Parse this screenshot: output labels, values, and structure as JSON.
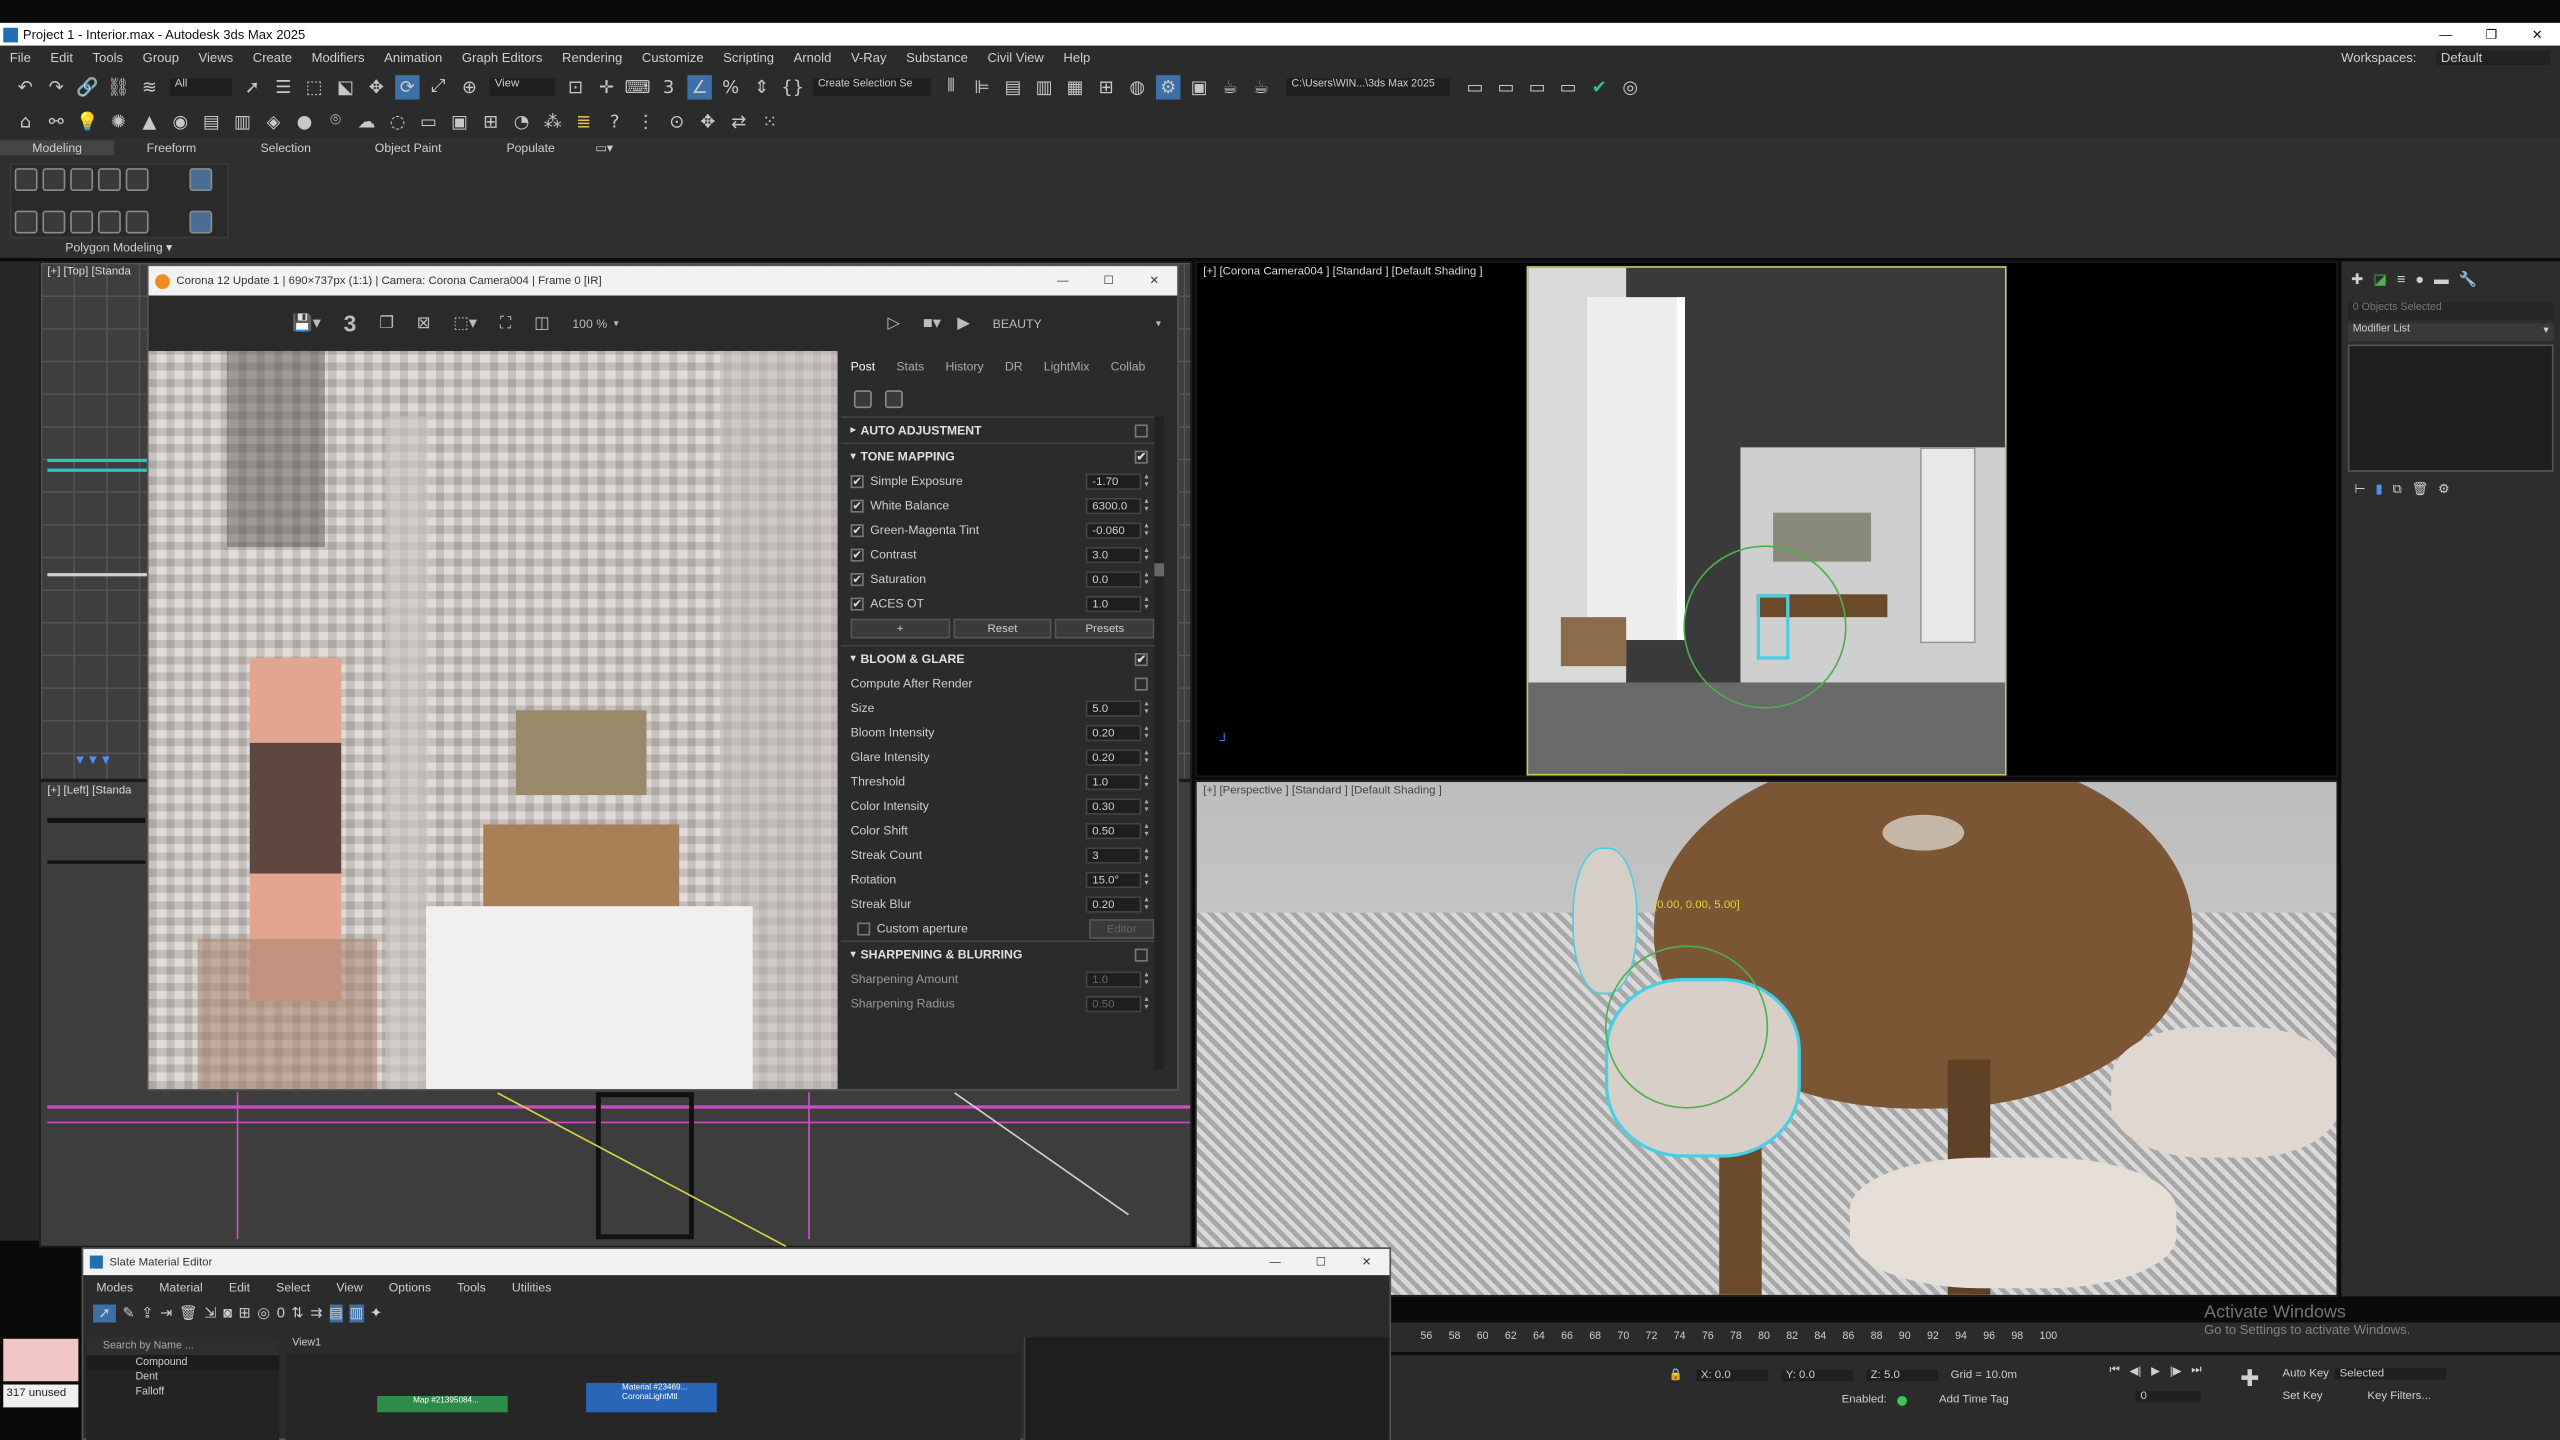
{
  "window": {
    "title": "Project 1 - Interior.max - Autodesk 3ds Max 2025"
  },
  "menu": [
    "File",
    "Edit",
    "Tools",
    "Group",
    "Views",
    "Create",
    "Modifiers",
    "Animation",
    "Graph Editors",
    "Rendering",
    "Customize",
    "Scripting",
    "Arnold",
    "V-Ray",
    "Substance",
    "Civil View",
    "Help"
  ],
  "workspaces": {
    "label": "Workspaces:",
    "value": "Default"
  },
  "toolbar": {
    "filter": "All",
    "view": "View",
    "selection_set": "Create Selection Se",
    "path": "C:\\Users\\WIN...\\3ds Max 2025"
  },
  "ribbon": {
    "tabs": [
      "Modeling",
      "Freeform",
      "Selection",
      "Object Paint",
      "Populate"
    ],
    "group": "Polygon Modeling"
  },
  "viewports": {
    "top": "[+] [Top] [Standa",
    "left": "[+] [Left] [Standa",
    "camera": "[+] [Corona Camera004 ] [Standard ] [Default Shading ]",
    "perspective": "[+] [Perspective ] [Standard ] [Default Shading ]",
    "gizmo_readout": "[0.00, 0.00, 5.00]"
  },
  "vfb": {
    "title": "Corona 12 Update 1 | 690×737px (1:1) | Camera: Corona Camera004 | Frame 0 [IR]",
    "zoom": "100 %",
    "pass": "BEAUTY",
    "tabs": [
      "Post",
      "Stats",
      "History",
      "DR",
      "LightMix",
      "Collab"
    ],
    "sections": {
      "auto": "AUTO ADJUSTMENT",
      "tone": "TONE MAPPING",
      "bloom": "BLOOM & GLARE",
      "sharp": "SHARPENING & BLURRING"
    },
    "tone_rows": [
      {
        "label": "Simple Exposure",
        "value": "-1.70"
      },
      {
        "label": "White Balance",
        "value": "6300.0"
      },
      {
        "label": "Green-Magenta Tint",
        "value": "-0.060"
      },
      {
        "label": "Contrast",
        "value": "3.0"
      },
      {
        "label": "Saturation",
        "value": "0.0"
      },
      {
        "label": "ACES OT",
        "value": "1.0"
      }
    ],
    "tone_buttons": [
      "+",
      "Reset",
      "Presets"
    ],
    "bloom_compute": "Compute After Render",
    "bloom_rows": [
      {
        "label": "Size",
        "value": "5.0"
      },
      {
        "label": "Bloom Intensity",
        "value": "0.20"
      },
      {
        "label": "Glare Intensity",
        "value": "0.20"
      },
      {
        "label": "Threshold",
        "value": "1.0"
      },
      {
        "label": "Color Intensity",
        "value": "0.30"
      },
      {
        "label": "Color Shift",
        "value": "0.50"
      },
      {
        "label": "Streak Count",
        "value": "3"
      },
      {
        "label": "Rotation",
        "value": "15.0°"
      },
      {
        "label": "Streak Blur",
        "value": "0.20"
      }
    ],
    "custom_aperture": "Custom aperture",
    "aperture_btn": "Editor",
    "sharp_rows": [
      {
        "label": "Sharpening Amount",
        "value": "1.0"
      },
      {
        "label": "Sharpening Radius",
        "value": "0.50"
      }
    ]
  },
  "command_panel": {
    "selected": "0 Objects Selected",
    "modifier_list": "Modifier List"
  },
  "slate": {
    "title": "Slate Material Editor",
    "menu": [
      "Modes",
      "Material",
      "Edit",
      "Select",
      "View",
      "Options",
      "Tools",
      "Utilities"
    ],
    "search": "Search by Name ...",
    "view_tab": "View1",
    "browser": [
      "Compound",
      "Dent",
      "Falloff"
    ],
    "node1": "Map #21395084...",
    "node2": "Material #23469... CoronaLightMtl"
  },
  "timeline": {
    "ticks": [
      "56",
      "58",
      "60",
      "62",
      "64",
      "66",
      "68",
      "70",
      "72",
      "74",
      "76",
      "78",
      "80",
      "82",
      "84",
      "86",
      "88",
      "90",
      "92",
      "94",
      "96",
      "98",
      "100"
    ]
  },
  "status": {
    "unused": "317 unused",
    "x": "X: 0.0",
    "y": "Y: 0.0",
    "z": "Z: 5.0",
    "grid": "Grid = 10.0m",
    "enabled": "Enabled:",
    "add_time_tag": "Add Time Tag",
    "auto_key": "Auto Key",
    "set_key": "Set Key",
    "selected": "Selected",
    "key_filters": "Key Filters...",
    "frame": "0"
  },
  "watermark": {
    "line1": "Activate Windows",
    "line2": "Go to Settings to activate Windows."
  }
}
